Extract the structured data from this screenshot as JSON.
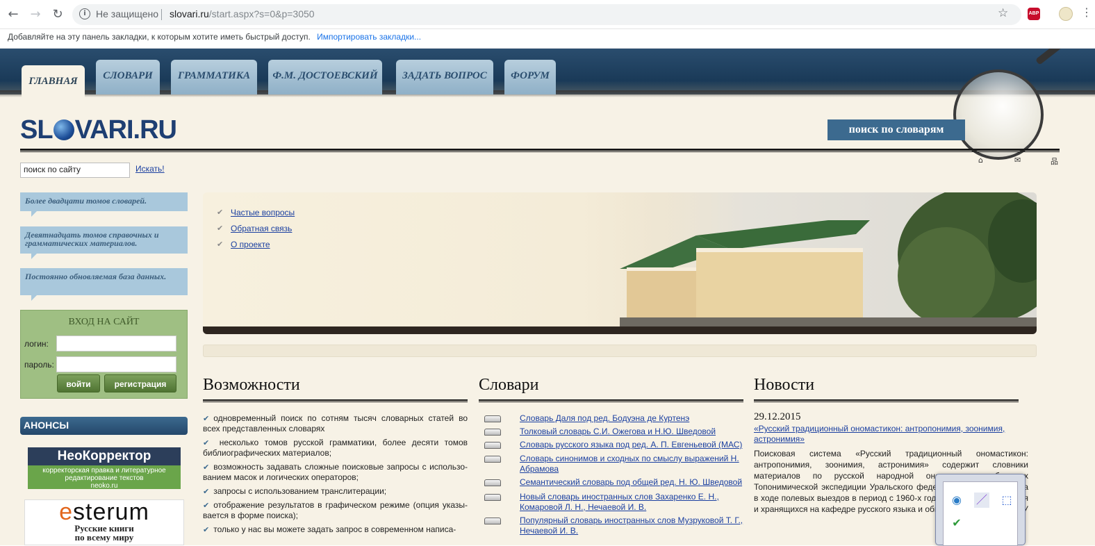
{
  "browser": {
    "nav": {
      "back": "←",
      "forward": "→",
      "reload": "↻"
    },
    "info_icon": "i",
    "insecure_label": "Не защищено",
    "url_host": "slovari.ru",
    "url_path": "/start.aspx?s=0&p=3050",
    "star": "☆",
    "abp": "ABP",
    "menu": "⋮",
    "bookmarks_prompt": "Добавляйте на эту панель закладки, к которым хотите иметь быстрый доступ.",
    "bookmarks_import": "Импортировать закладки..."
  },
  "tabs": [
    "ГЛАВНАЯ",
    "СЛОВАРИ",
    "ГРАММАТИКА",
    "Ф.М. ДОСТОЕВСКИЙ",
    "ЗАДАТЬ ВОПРОС",
    "ФОРУМ"
  ],
  "header": {
    "logo_left": "SL",
    "logo_right": "VARI.RU",
    "search_dicts_button": "поиск по словарям"
  },
  "site_search": {
    "value": "поиск по сайту",
    "button": "Искать!"
  },
  "util_icons": {
    "home": "⌂",
    "mail": "✉",
    "sitemap": "品"
  },
  "bubbles": [
    "Более двадцати томов словарей.",
    "Девятнадцать томов справочных и грамматических материалов.",
    "Постоянно обновляемая база данных."
  ],
  "login": {
    "title": "ВХОД НА САЙТ",
    "login_label": "логин:",
    "password_label": "пароль:",
    "enter_button": "войти",
    "register_button": "регистрация"
  },
  "anons": {
    "title": "АНОНСЫ",
    "neo_title": "НеоКорректор",
    "neo_sub1": "корректорская правка и литературное",
    "neo_sub2": "редактирование текстов",
    "neo_url": "neoko.ru",
    "esterum_logo": "esterum",
    "esterum_sub1": "Русские книги",
    "esterum_sub2": "по всему миру"
  },
  "hero_links": [
    "Частые вопросы",
    "Обратная связь",
    "О проекте"
  ],
  "columns": {
    "features_title": "Возможности",
    "dicts_title": "Словари",
    "news_title": "Новости"
  },
  "features": [
    "одновременный поиск по сотням тысяч словарных статей во всех представленных словарях",
    " несколько томов русской грамматики, более десяти томов библиографических материалов;",
    "возможность задавать сложные поисковые запросы с использо-ванием масок и логических операторов;",
    "запросы с использованием транслитерации;",
    "отображение результатов в графическом режиме (опция указы-вается в форме поиска);",
    "только у нас вы можете задать запрос в современном написа-"
  ],
  "dictionaries": [
    "Словарь Даля под ред. Бодуэна де Куртенэ",
    "Толковый словарь С.И. Ожегова и Н.Ю. Шведовой",
    "Словарь русского языка под ред. А. П. Евгеньевой (МАС)",
    "Словарь синонимов и сходных по смыслу выражений Н. Абрамова",
    "Семантический словарь под общей ред. Н. Ю. Шведовой",
    "Новый словарь иностранных слов Захаренко Е. Н., Комаровой Л. Н., Нечаевой И. В.",
    "Популярный словарь иностранных слов Музруковой Т. Г., Нечаевой И. В."
  ],
  "news": {
    "date": "29.12.2015",
    "title": "«Русский традиционный ономастикон: антропонимия, зоонимия, астронимия»",
    "body": "Поисковая система «Русский традиционный ономастикон: антропонимия, зоонимия, астронимия» содержит словники материалов по русской народной ономастике, собранных Топонимической экспедиции Уральского федерального университета в ходе полевых выездов в период с 1960-х годов по настоящее время и хранящихся на кафедре русского языка и общего языкознания УрФУ"
  },
  "colors": {
    "navy": "#1e3f73",
    "tab_blue": "#a9c8dc",
    "login_green": "#9fbf83",
    "link": "#1a3fa0",
    "page_bg": "#f7f2e6"
  }
}
